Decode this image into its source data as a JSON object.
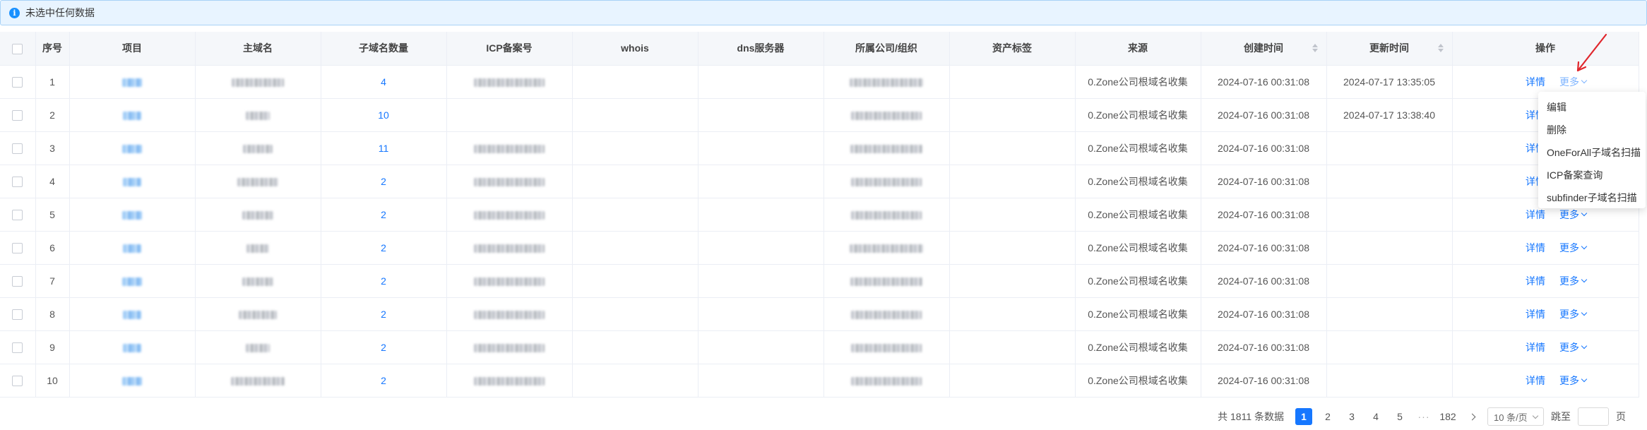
{
  "alert": {
    "text": "未选中任何数据"
  },
  "table": {
    "columns": [
      "序号",
      "项目",
      "主域名",
      "子域名数量",
      "ICP备案号",
      "whois",
      "dns服务器",
      "所属公司/组织",
      "资产标签",
      "来源",
      "创建时间",
      "更新时间",
      "操作"
    ],
    "rows": [
      {
        "index": "1",
        "subdomain_count": "4",
        "has_icp": true,
        "source": "0.Zone公司根域名收集",
        "created": "2024-07-16 00:31:08",
        "updated": "2024-07-17 13:35:05"
      },
      {
        "index": "2",
        "subdomain_count": "10",
        "has_icp": false,
        "source": "0.Zone公司根域名收集",
        "created": "2024-07-16 00:31:08",
        "updated": "2024-07-17 13:38:40"
      },
      {
        "index": "3",
        "subdomain_count": "11",
        "has_icp": true,
        "source": "0.Zone公司根域名收集",
        "created": "2024-07-16 00:31:08",
        "updated": ""
      },
      {
        "index": "4",
        "subdomain_count": "2",
        "has_icp": true,
        "source": "0.Zone公司根域名收集",
        "created": "2024-07-16 00:31:08",
        "updated": ""
      },
      {
        "index": "5",
        "subdomain_count": "2",
        "has_icp": true,
        "source": "0.Zone公司根域名收集",
        "created": "2024-07-16 00:31:08",
        "updated": ""
      },
      {
        "index": "6",
        "subdomain_count": "2",
        "has_icp": true,
        "source": "0.Zone公司根域名收集",
        "created": "2024-07-16 00:31:08",
        "updated": ""
      },
      {
        "index": "7",
        "subdomain_count": "2",
        "has_icp": true,
        "source": "0.Zone公司根域名收集",
        "created": "2024-07-16 00:31:08",
        "updated": ""
      },
      {
        "index": "8",
        "subdomain_count": "2",
        "has_icp": true,
        "source": "0.Zone公司根域名收集",
        "created": "2024-07-16 00:31:08",
        "updated": ""
      },
      {
        "index": "9",
        "subdomain_count": "2",
        "has_icp": true,
        "source": "0.Zone公司根域名收集",
        "created": "2024-07-16 00:31:08",
        "updated": ""
      },
      {
        "index": "10",
        "subdomain_count": "2",
        "has_icp": true,
        "source": "0.Zone公司根域名收集",
        "created": "2024-07-16 00:31:08",
        "updated": ""
      }
    ],
    "action_detail": "详情",
    "action_more": "更多"
  },
  "dropdown": {
    "items": [
      "编辑",
      "删除",
      "OneForAll子域名扫描",
      "ICP备案查询",
      "subfinder子域名扫描"
    ]
  },
  "pagination": {
    "total_text": "共 1811 条数据",
    "pages": [
      "1",
      "2",
      "3",
      "4",
      "5"
    ],
    "ellipsis": "···",
    "last_page": "182",
    "page_size": "10 条/页",
    "jump_label": "跳至",
    "page_suffix": "页"
  },
  "colors": {
    "accent": "#1677ff",
    "annotation_arrow": "#e0262c",
    "header_bg": "#f5f7fa"
  }
}
